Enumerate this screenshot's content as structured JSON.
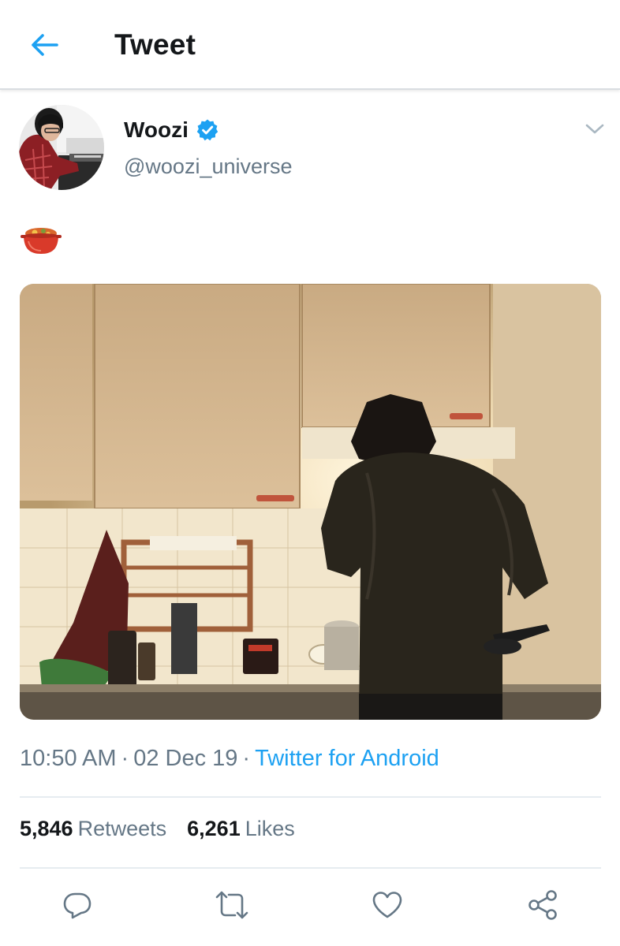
{
  "header": {
    "title": "Tweet",
    "back_icon": "arrow-left-icon"
  },
  "tweet": {
    "author": {
      "display_name": "Woozi",
      "handle": "@woozi_universe",
      "verified": true
    },
    "body_emoji": "pot-of-food-emoji",
    "media_description_icon": "photo",
    "time": "10:50 AM",
    "date": "02 Dec 19",
    "separator": "·",
    "source": "Twitter for Android",
    "stats": {
      "retweets_count": "5,846",
      "retweets_label": "Retweets",
      "likes_count": "6,261",
      "likes_label": "Likes"
    },
    "actions": [
      "reply-icon",
      "retweet-icon",
      "like-icon",
      "share-icon"
    ]
  },
  "colors": {
    "accent": "#1da1f2",
    "text_primary": "#14171a",
    "text_secondary": "#657786",
    "divider": "#e6ecf0"
  }
}
